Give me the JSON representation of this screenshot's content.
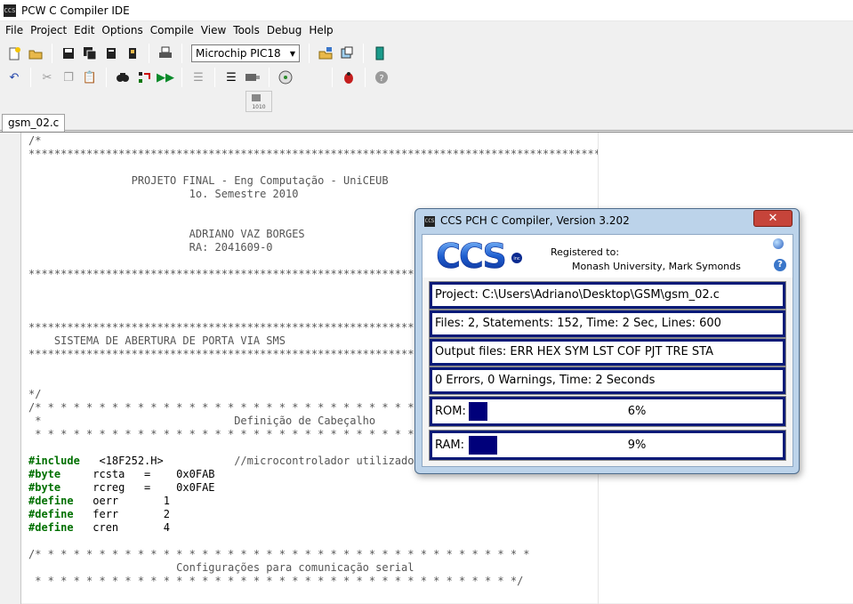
{
  "window": {
    "title": "PCW C Compiler IDE",
    "app_icon_text": "CCS"
  },
  "menu": [
    "File",
    "Project",
    "Edit",
    "Options",
    "Compile",
    "View",
    "Tools",
    "Debug",
    "Help"
  ],
  "toolbar": {
    "chip": "Microchip PIC18"
  },
  "tabs": [
    "gsm_02.c"
  ],
  "code_lines": [
    [
      {
        "t": "/*",
        "c": "cm"
      }
    ],
    [
      {
        "t": "*****************************************************************************************************",
        "c": "cm"
      }
    ],
    [
      {
        "t": "",
        "c": "cm"
      }
    ],
    [
      {
        "t": "                PROJETO FINAL - Eng Computação - UniCEUB",
        "c": "cm"
      }
    ],
    [
      {
        "t": "                         1o. Semestre 2010",
        "c": "cm"
      }
    ],
    [
      {
        "t": "",
        "c": "cm"
      }
    ],
    [
      {
        "t": "",
        "c": "cm"
      }
    ],
    [
      {
        "t": "                         ADRIANO VAZ BORGES",
        "c": "cm"
      }
    ],
    [
      {
        "t": "                         RA: 2041609-0",
        "c": "cm"
      }
    ],
    [
      {
        "t": "",
        "c": "cm"
      }
    ],
    [
      {
        "t": "*****************************************************************************************************",
        "c": "cm"
      }
    ],
    [
      {
        "t": "",
        "c": "cm"
      }
    ],
    [
      {
        "t": "",
        "c": "cm"
      }
    ],
    [
      {
        "t": "",
        "c": "cm"
      }
    ],
    [
      {
        "t": "*****************************************************************************************************",
        "c": "cm"
      }
    ],
    [
      {
        "t": "    SISTEMA DE ABERTURA DE PORTA VIA SMS",
        "c": "cm"
      }
    ],
    [
      {
        "t": "*****************************************************************************************************",
        "c": "cm"
      }
    ],
    [
      {
        "t": "",
        "c": "cm"
      }
    ],
    [
      {
        "t": "",
        "c": "cm"
      }
    ],
    [
      {
        "t": "*/",
        "c": "cm"
      }
    ],
    [
      {
        "t": "/* * * * * * * * * * * * * * * * * * * * * * * * * * * * * * * * * * * * * *",
        "c": "cm"
      }
    ],
    [
      {
        "t": " *                              Definição de Cabeçalho",
        "c": "cm"
      }
    ],
    [
      {
        "t": " * * * * * * * * * * * * * * * * * * * * * * * * * * * * * * * * * * * * * *",
        "c": "cm"
      }
    ],
    [
      {
        "t": "",
        "c": "cm"
      }
    ],
    [
      {
        "t": "#include",
        "c": "kw"
      },
      {
        "t": "   <18F252.H>           ",
        "c": "pl"
      },
      {
        "t": "//microcontrolador utilizado",
        "c": "cm"
      }
    ],
    [
      {
        "t": "#byte",
        "c": "kw"
      },
      {
        "t": "     rcsta   =    0x0FAB",
        "c": "pl"
      }
    ],
    [
      {
        "t": "#byte",
        "c": "kw"
      },
      {
        "t": "     rcreg   =    0x0FAE",
        "c": "pl"
      }
    ],
    [
      {
        "t": "#define",
        "c": "kw"
      },
      {
        "t": "   oerr       1",
        "c": "pl"
      }
    ],
    [
      {
        "t": "#define",
        "c": "kw"
      },
      {
        "t": "   ferr       2",
        "c": "pl"
      }
    ],
    [
      {
        "t": "#define",
        "c": "kw"
      },
      {
        "t": "   cren       4",
        "c": "pl"
      }
    ],
    [
      {
        "t": "",
        "c": "cm"
      }
    ],
    [
      {
        "t": "/* * * * * * * * * * * * * * * * * * * * * * * * * * * * * * * * * * * * * * *",
        "c": "cm"
      }
    ],
    [
      {
        "t": "                       Configurações para comunicação serial",
        "c": "cm"
      }
    ],
    [
      {
        "t": " * * * * * * * * * * * * * * * * * * * * * * * * * * * * * * * * * * * * * */",
        "c": "cm"
      }
    ]
  ],
  "dialog": {
    "title": "CCS PCH C Compiler, Version 3.202",
    "logo_text": "CCS",
    "logo_sub": "inc",
    "close_label": "✕",
    "registered_label": "Registered to:",
    "registered_name": "Monash University, Mark Symonds",
    "project": "Project:  C:\\Users\\Adriano\\Desktop\\GSM\\gsm_02.c",
    "files": "Files: 2,  Statements: 152,  Time: 2 Sec,  Lines: 600",
    "output": "Output files: ERR  HEX  SYM  LST  COF  PJT  TRE  STA",
    "errors": "0 Errors,  0 Warnings,  Time: 2 Seconds",
    "rom_label": "ROM:",
    "rom_text": "6%",
    "rom_fraction": 0.06,
    "ram_label": "RAM:",
    "ram_text": "9%",
    "ram_fraction": 0.09,
    "bar_color": "#00007a"
  }
}
